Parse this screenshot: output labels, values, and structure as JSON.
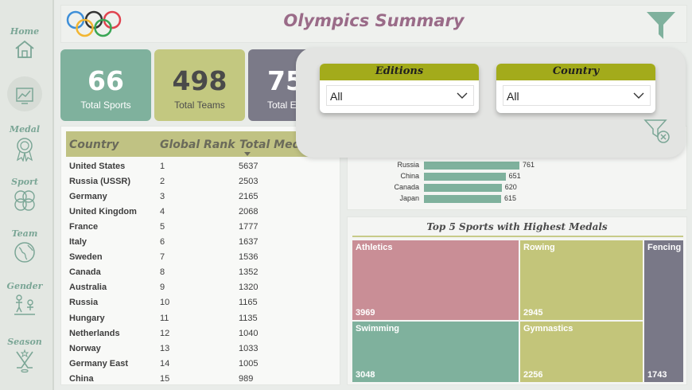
{
  "header": {
    "title": "Olympics Summary"
  },
  "nav": [
    {
      "label": "Home",
      "icon": "home-icon"
    },
    {
      "label": "",
      "icon": "chart-icon"
    },
    {
      "label": "Medal",
      "icon": "medal-icon"
    },
    {
      "label": "Sport",
      "icon": "sport-icon"
    },
    {
      "label": "Team",
      "icon": "globe-icon"
    },
    {
      "label": "Gender",
      "icon": "gender-icon"
    },
    {
      "label": "Season",
      "icon": "hockey-icon"
    }
  ],
  "kpis": [
    {
      "value": "66",
      "label": "Total Sports"
    },
    {
      "value": "498",
      "label": "Total Teams"
    },
    {
      "value": "75",
      "label": "Total E"
    }
  ],
  "table": {
    "headers": [
      "Country",
      "Global Rank",
      "Total Meda"
    ],
    "rows": [
      [
        "United States",
        "1",
        "5637"
      ],
      [
        "Russia (USSR)",
        "2",
        "2503"
      ],
      [
        "Germany",
        "3",
        "2165"
      ],
      [
        "United Kingdom",
        "4",
        "2068"
      ],
      [
        "France",
        "5",
        "1777"
      ],
      [
        "Italy",
        "6",
        "1637"
      ],
      [
        "Sweden",
        "7",
        "1536"
      ],
      [
        "Canada",
        "8",
        "1352"
      ],
      [
        "Australia",
        "9",
        "1320"
      ],
      [
        "Russia",
        "10",
        "1165"
      ],
      [
        "Hungary",
        "11",
        "1135"
      ],
      [
        "Netherlands",
        "12",
        "1040"
      ],
      [
        "Norway",
        "13",
        "1033"
      ],
      [
        "Germany East",
        "14",
        "1005"
      ],
      [
        "China",
        "15",
        "989"
      ]
    ]
  },
  "country_bars": {
    "max_value": 761,
    "items": [
      {
        "country": "Russia",
        "value": 761
      },
      {
        "country": "China",
        "value": 651
      },
      {
        "country": "Canada",
        "value": 620
      },
      {
        "country": "Japan",
        "value": 615
      }
    ]
  },
  "treemap": {
    "title": "Top 5 Sports with Highest Medals",
    "tiles": [
      {
        "name": "Athletics",
        "value": "3969",
        "color": "#c98e96"
      },
      {
        "name": "Rowing",
        "value": "2945",
        "color": "#c3c57a"
      },
      {
        "name": "Fencing",
        "value": "1743",
        "color": "#797887"
      },
      {
        "name": "Swimming",
        "value": "3048",
        "color": "#7fb19d"
      },
      {
        "name": "Gymnastics",
        "value": "2256",
        "color": "#c3c57a"
      }
    ]
  },
  "filters": {
    "editions": {
      "label": "Editions",
      "value": "All"
    },
    "country": {
      "label": "Country",
      "value": "All"
    }
  },
  "colors": {
    "accent_green": "#7fb19d",
    "accent_olive": "#c3c880",
    "accent_grey": "#7b7a88",
    "title": "#9a6b88",
    "slicer_header": "#a3ab1b"
  }
}
